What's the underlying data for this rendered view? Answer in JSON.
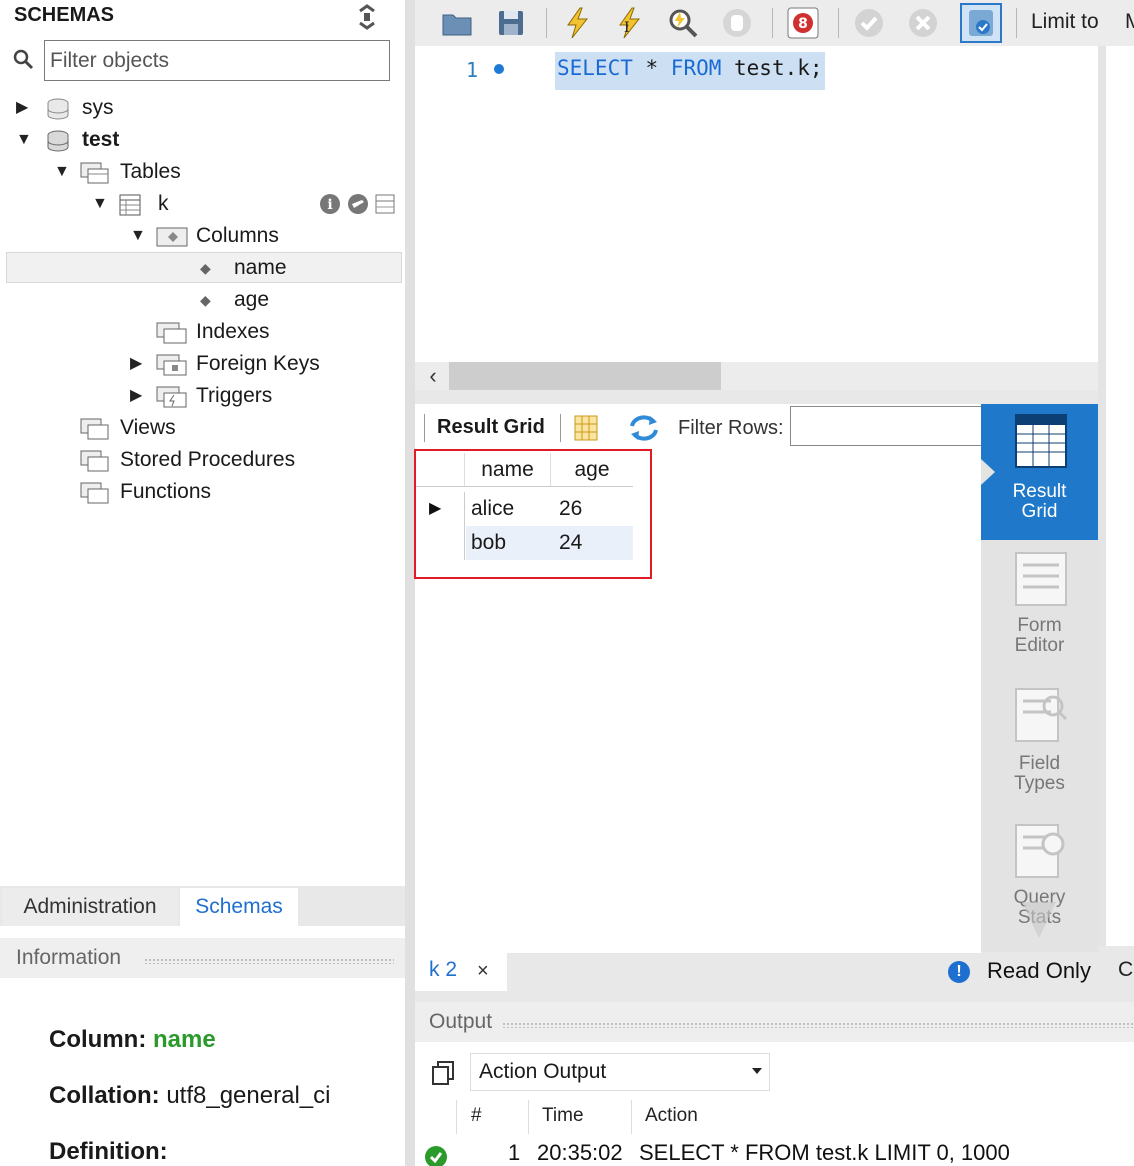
{
  "sidebar": {
    "header": "SCHEMAS",
    "filter_placeholder": "Filter objects",
    "tree": {
      "sys": "sys",
      "test": "test",
      "tables": "Tables",
      "table_k": "k",
      "columns": "Columns",
      "col_name": "name",
      "col_age": "age",
      "indexes": "Indexes",
      "foreign_keys": "Foreign Keys",
      "triggers": "Triggers",
      "views": "Views",
      "stored_procedures": "Stored Procedures",
      "functions": "Functions"
    },
    "tabs": {
      "administration": "Administration",
      "schemas": "Schemas"
    },
    "info": {
      "header": "Information",
      "column_key": "Column:",
      "column_val": "name",
      "collation_key": "Collation:",
      "collation_val": "utf8_general_ci",
      "definition_key": "Definition:"
    }
  },
  "toolbar": {
    "limit_label": "Limit to",
    "limit_overflow": "M"
  },
  "editor": {
    "line_number": "1",
    "sql_keyword_1": "SELECT",
    "sql_middle": " * ",
    "sql_keyword_2": "FROM",
    "sql_rest": " test.k;"
  },
  "result": {
    "grid_label": "Result Grid",
    "filter_rows_label": "Filter Rows:",
    "columns": [
      "name",
      "age"
    ],
    "rows": [
      [
        "alice",
        "26"
      ],
      [
        "bob",
        "24"
      ]
    ],
    "side": {
      "result_grid_1": "Result",
      "result_grid_2": "Grid",
      "form_editor_1": "Form",
      "form_editor_2": "Editor",
      "field_types_1": "Field",
      "field_types_2": "Types",
      "query_stats_1": "Query",
      "query_stats_2": "Stats"
    }
  },
  "tabs": {
    "result_tab": "k 2",
    "close_glyph": "×",
    "read_only": "Read Only",
    "next_tab": "C"
  },
  "output": {
    "header": "Output",
    "select_value": "Action Output",
    "columns": {
      "num": "#",
      "time": "Time",
      "action": "Action"
    },
    "rows": [
      {
        "num": "1",
        "time": "20:35:02",
        "action": "SELECT * FROM test.k LIMIT 0, 1000"
      }
    ]
  },
  "colors": {
    "accent": "#1f78c9",
    "highlight_box": "#e01b24",
    "keyword": "#1a6ad4",
    "ok": "#2a9a2a"
  }
}
